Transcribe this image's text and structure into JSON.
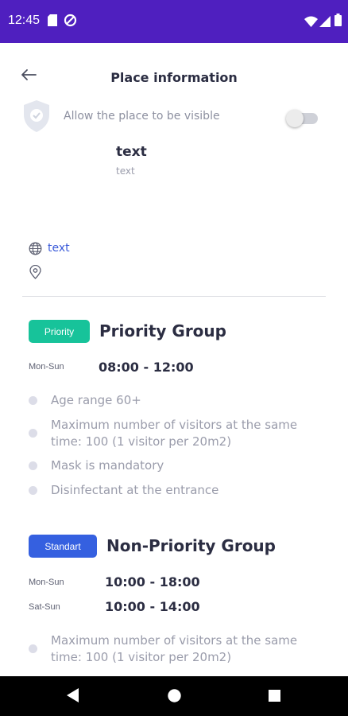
{
  "status_bar": {
    "time": "12:45",
    "background": "#4f1fbf"
  },
  "header": {
    "title": "Place information",
    "back_icon": "arrow-back-icon"
  },
  "visibility": {
    "label": "Allow the place to be visible",
    "enabled": false,
    "icon": "shield-check-icon"
  },
  "place": {
    "name": "text",
    "subtitle": "text",
    "website": "text",
    "address": ""
  },
  "groups": [
    {
      "badge": "Priority",
      "badge_color": "#17c39a",
      "title": "Priority Group",
      "schedule": [
        {
          "days": "Mon-Sun",
          "time": "08:00 - 12:00"
        }
      ],
      "rules": [
        "Age range 60+",
        "Maximum number of visitors at the same time: 100 (1 visitor per 20m2)",
        "Mask is mandatory",
        "Disinfectant at the entrance"
      ]
    },
    {
      "badge": "Standart",
      "badge_color": "#3560e0",
      "title": "Non-Priority Group",
      "schedule": [
        {
          "days": "Mon-Sun",
          "time": "10:00 - 18:00"
        },
        {
          "days": "Sat-Sun",
          "time": "10:00 - 14:00"
        }
      ],
      "rules": [
        "Maximum number of visitors at the same time: 100 (1 visitor per 20m2)"
      ]
    }
  ],
  "nav": {
    "back": "nav-back-icon",
    "home": "nav-home-icon",
    "recents": "nav-recents-icon"
  }
}
